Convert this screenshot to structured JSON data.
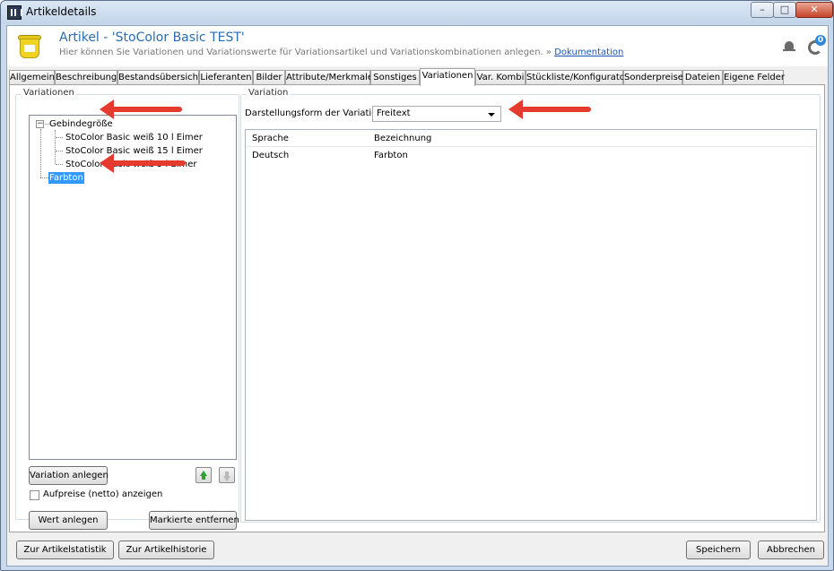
{
  "window": {
    "title": "Artikeldetails",
    "controls": {
      "minimize": "–",
      "maximize": "□",
      "close": "✕"
    }
  },
  "header": {
    "title": "Artikel - 'StoColor Basic TEST'",
    "subtitle": "Hier können Sie Variationen und Variationswerte für Variationsartikel und Variationskombinationen anlegen.",
    "subtitle_sep": " » ",
    "doc_link": "Dokumentation",
    "notification_count": "0",
    "icons": [
      "bucket-icon",
      "bell-icon",
      "sync-icon"
    ]
  },
  "tabs": [
    "Allgemein",
    "Beschreibung",
    "Bestandsübersicht",
    "Lieferanten",
    "Bilder",
    "Attribute/Merkmale",
    "Sonstiges",
    "Variationen",
    "Var. Kombi",
    "Stückliste/Konfigurator",
    "Sonderpreise",
    "Dateien",
    "Eigene Felder"
  ],
  "active_tab": "Variationen",
  "left": {
    "group_label": "Variationen",
    "tree": {
      "root": "Gebindegröße",
      "children": [
        "StoColor Basic weiß 10 l Eimer",
        "StoColor Basic weiß 15 l Eimer",
        "StoColor Basic weiß 5 l Eimer"
      ],
      "second_root": "Farbton",
      "expander": "−"
    },
    "add_variation_button": "Variation anlegen",
    "checkbox_label": "Aufpreise (netto) anzeigen",
    "checkbox_checked": false,
    "add_value_button": "Wert anlegen",
    "remove_selected_button": "Markierte entfernen"
  },
  "right": {
    "group_label": "Variation",
    "display_form_label": "Darstellungsform der Variation:",
    "display_form_value": "Freitext",
    "grid": {
      "columns": [
        "Sprache",
        "Bezeichnung"
      ],
      "rows": [
        {
          "sprache": "Deutsch",
          "bezeichnung": "Farbton"
        }
      ]
    }
  },
  "footer": {
    "stats_button": "Zur Artikelstatistik",
    "history_button": "Zur Artikelhistorie",
    "save_button": "Speichern",
    "cancel_button": "Abbrechen"
  },
  "colors": {
    "accent_title": "#2b6cb0",
    "selection": "#3399ff",
    "annotation_arrow": "#e53a2e",
    "badge": "#2d87d8"
  }
}
